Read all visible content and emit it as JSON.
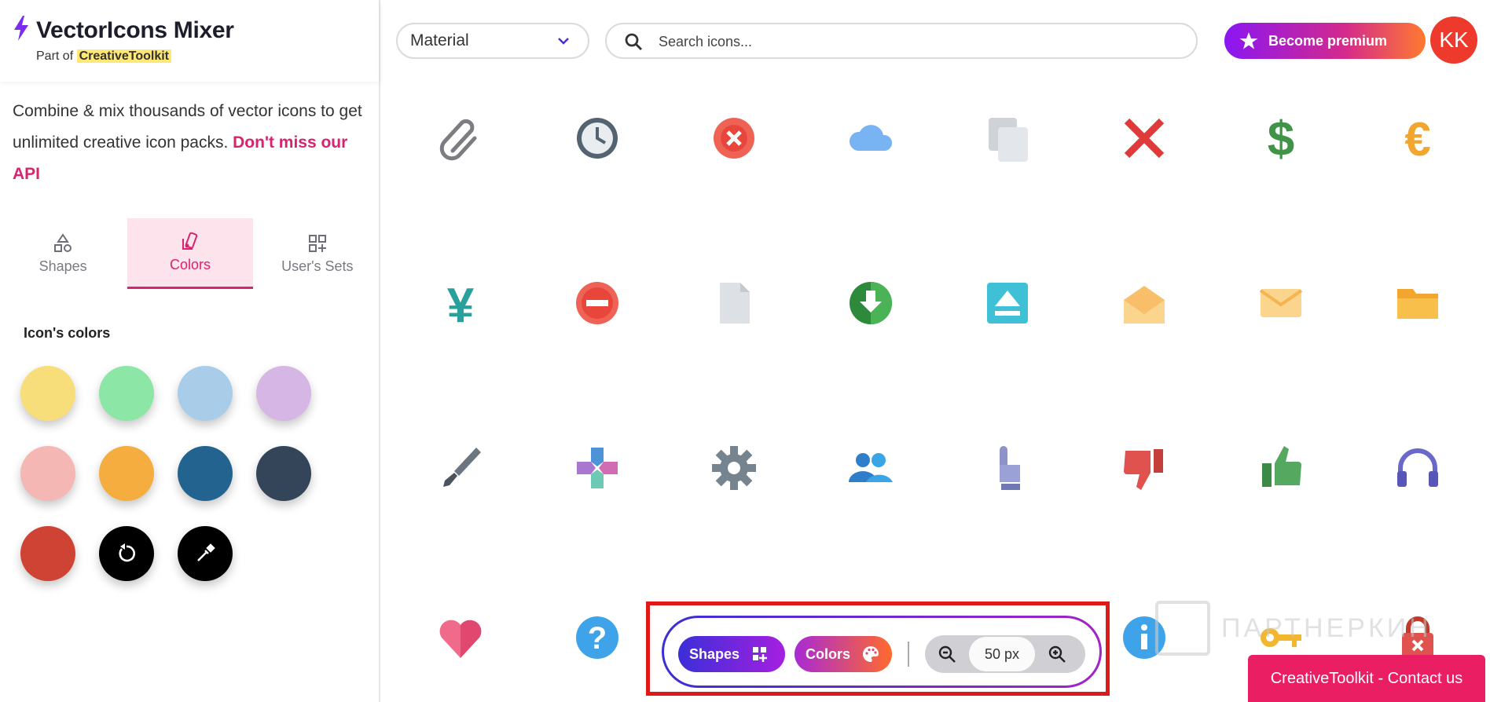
{
  "brand": {
    "title": "VectorIcons Mixer",
    "part_of": "Part of",
    "toolkit": "CreativeToolkit"
  },
  "intro": {
    "text": "Combine & mix thousands of vector icons to get unlimited creative icon packs. ",
    "api_link": "Don't miss our API"
  },
  "tabs": [
    {
      "label": "Shapes",
      "icon": "shapes-icon",
      "active": false
    },
    {
      "label": "Colors",
      "icon": "colors-icon",
      "active": true
    },
    {
      "label": "User's Sets",
      "icon": "user-sets-icon",
      "active": false
    }
  ],
  "colors_panel": {
    "title": "Icon's colors",
    "swatches": [
      "#f8de7a",
      "#8ce6a6",
      "#a9cde8",
      "#d5b6e4",
      "#f5b7b3",
      "#f5ad3f",
      "#23638f",
      "#344559",
      "#cf4334"
    ],
    "actions": [
      "reset-icon",
      "color-picker-icon"
    ]
  },
  "toolbar": {
    "icon_set": "Material",
    "search_placeholder": "Search icons...",
    "premium_label": "Become premium",
    "avatar_initials": "KK"
  },
  "icons": [
    "paperclip-icon",
    "clock-icon",
    "close-circle-icon",
    "cloud-icon",
    "copy-icon",
    "close-icon",
    "dollar-icon",
    "euro-icon",
    "yen-icon",
    "do-not-enter-icon",
    "file-icon",
    "download-circle-icon",
    "eject-icon",
    "mail-open-icon",
    "mail-icon",
    "folder-icon",
    "brush-icon",
    "gamepad-icon",
    "gear-icon",
    "group-icon",
    "hand-pointer-icon",
    "thumb-down-icon",
    "thumb-up-icon",
    "headphones-icon",
    "heart-icon",
    "help-circle-icon",
    "info-circle-icon",
    "key-icon",
    "lock-icon"
  ],
  "float_bar": {
    "shapes_label": "Shapes",
    "colors_label": "Colors",
    "zoom_value": "50 px"
  },
  "watermark": "ПАРТНЕРКИН",
  "contact": "CreativeToolkit - Contact us"
}
